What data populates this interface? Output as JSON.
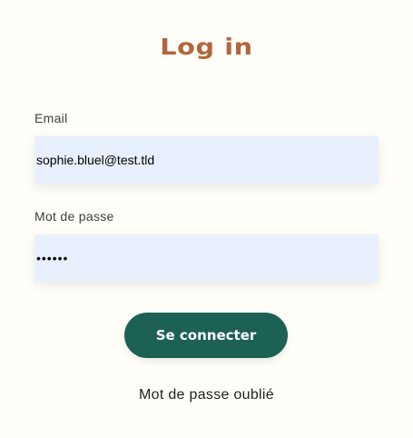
{
  "login": {
    "title": "Log in",
    "email_label": "Email",
    "email_value": "sophie.bluel@test.tld",
    "password_label": "Mot de passe",
    "password_value": "S0phie",
    "submit_label": "Se connecter",
    "forgot_label": "Mot de passe oublié"
  },
  "colors": {
    "background": "#fffef8",
    "title": "#b1663c",
    "input_background": "#e8f0fe",
    "button_background": "#1d6154",
    "button_text": "#ffffff"
  }
}
